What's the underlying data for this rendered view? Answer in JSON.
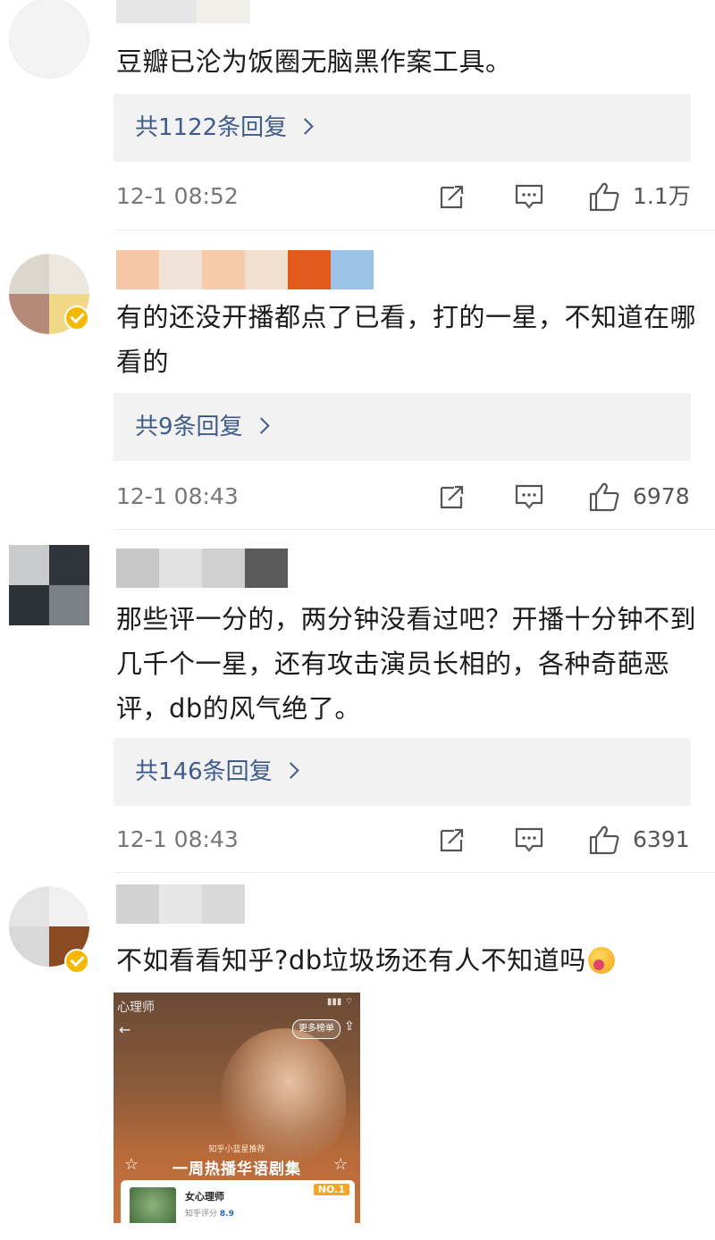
{
  "comments": [
    {
      "text": "豆瓣已沦为饭圈无脑黑作案工具。",
      "replies": "共1122条回复",
      "time": "12-1 08:52",
      "likes": "1.1万"
    },
    {
      "text": "有的还没开播都点了已看，打的一星，不知道在哪看的",
      "replies": "共9条回复",
      "time": "12-1 08:43",
      "likes": "6978"
    },
    {
      "text": "那些评一分的，两分钟没看过吧？开播十分钟不到几千个一星，还有攻击演员长相的，各种奇葩恶评，db的风气绝了。",
      "replies": "共146条回复",
      "time": "12-1 08:43",
      "likes": "6391"
    },
    {
      "text": "不如看看知乎?db垃圾场还有人不知道吗"
    }
  ],
  "attachment": {
    "brand": "心理师",
    "more_button": "更多榜单",
    "subtitle": "知乎小蓝星推荐",
    "headline": "一周热播华语剧集",
    "show_title": "女心理师",
    "score_label": "知乎评分",
    "score_value": "8.9",
    "rank": "NO.1"
  },
  "icons": [
    "share-icon",
    "comment-icon",
    "like-icon",
    "verified-icon",
    "chevron-right-icon",
    "emoji-icon"
  ],
  "colors": {
    "reply_link": "#3f5c8c",
    "reply_bg": "#f2f2f2",
    "verified": "#f5b800",
    "meta_text": "#777777"
  }
}
